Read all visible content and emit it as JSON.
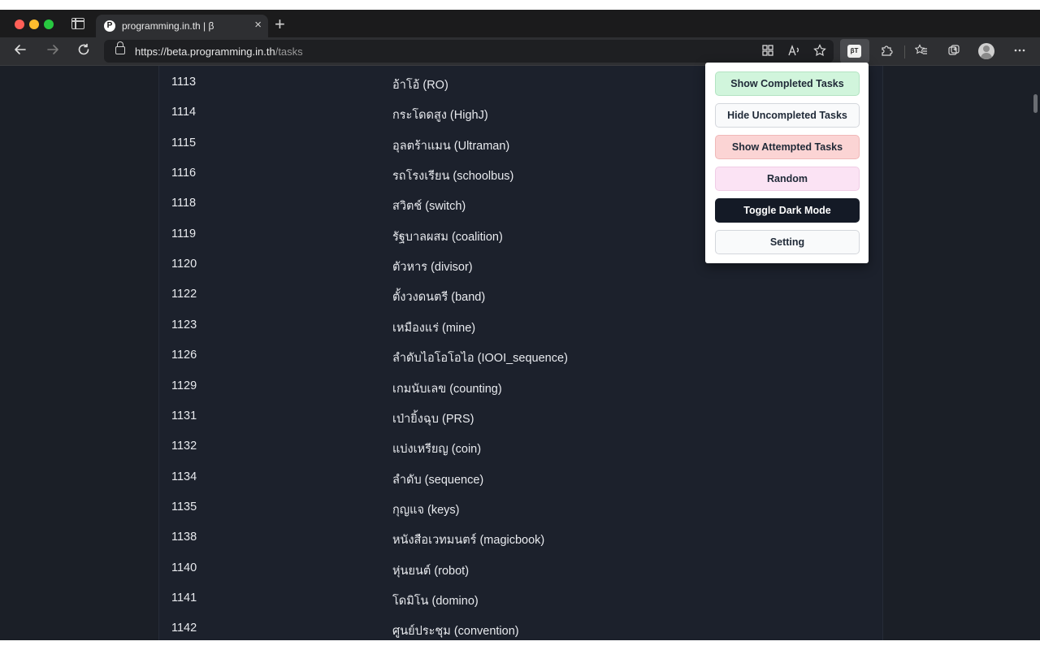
{
  "browser": {
    "tab": {
      "favicon": "P",
      "title": "programming.in.th | β",
      "close_glyph": "×"
    },
    "new_tab_glyph": "+",
    "url": {
      "host": "https://beta.programming.in.th",
      "path": "/tasks"
    },
    "extension_badge": "βT"
  },
  "tasks": [
    {
      "id": "1113",
      "name": "อ้าโอ้ (RO)"
    },
    {
      "id": "1114",
      "name": "กระโดดสูง (HighJ)"
    },
    {
      "id": "1115",
      "name": "อุลตร้าแมน (Ultraman)"
    },
    {
      "id": "1116",
      "name": "รถโรงเรียน (schoolbus)"
    },
    {
      "id": "1118",
      "name": "สวิตช์ (switch)"
    },
    {
      "id": "1119",
      "name": "รัฐบาลผสม (coalition)"
    },
    {
      "id": "1120",
      "name": "ตัวหาร (divisor)"
    },
    {
      "id": "1122",
      "name": "ตั้งวงดนตรี (band)"
    },
    {
      "id": "1123",
      "name": "เหมืองแร่ (mine)"
    },
    {
      "id": "1126",
      "name": "ลำดับไอโอโอไอ (IOOI_sequence)"
    },
    {
      "id": "1129",
      "name": "เกมนับเลข (counting)"
    },
    {
      "id": "1131",
      "name": "เป่ายิ้งฉุบ (PRS)"
    },
    {
      "id": "1132",
      "name": "แบ่งเหรียญ (coin)"
    },
    {
      "id": "1134",
      "name": "ลำดับ (sequence)"
    },
    {
      "id": "1135",
      "name": "กุญแจ (keys)"
    },
    {
      "id": "1138",
      "name": "หนังสือเวทมนตร์ (magicbook)"
    },
    {
      "id": "1140",
      "name": "หุ่นยนต์ (robot)"
    },
    {
      "id": "1141",
      "name": "โดมิโน (domino)"
    },
    {
      "id": "1142",
      "name": "ศูนย์ประชุม (convention)"
    }
  ],
  "popup": {
    "show_completed": "Show Completed Tasks",
    "hide_uncompleted": "Hide Uncompleted Tasks",
    "show_attempted": "Show Attempted Tasks",
    "random": "Random",
    "toggle_dark": "Toggle Dark Mode",
    "setting": "Setting"
  }
}
